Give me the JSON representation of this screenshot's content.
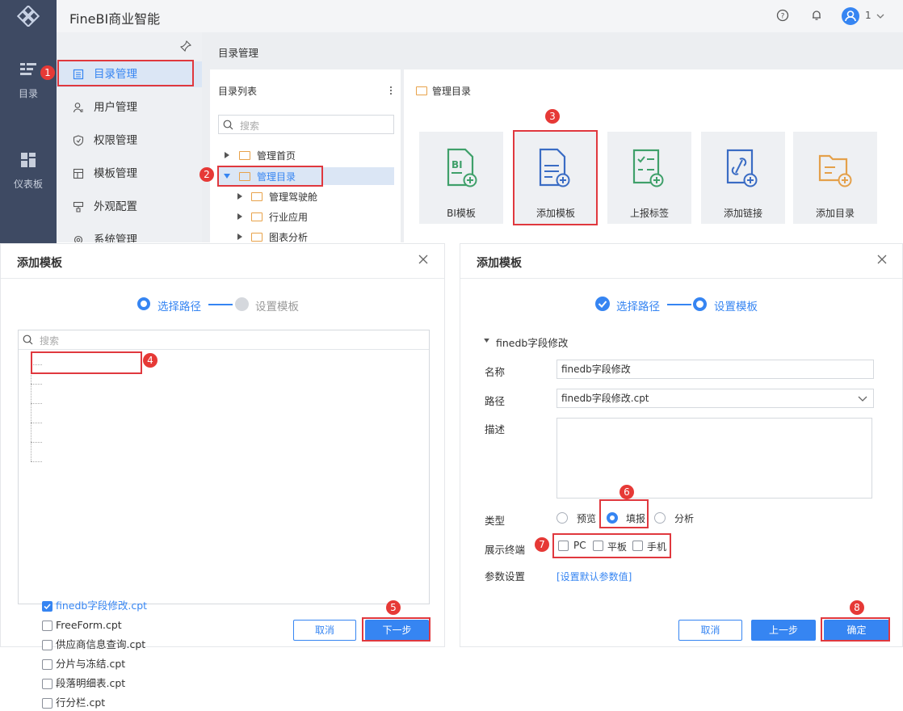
{
  "app": {
    "title": "FineBI商业智能",
    "user_num": "1"
  },
  "rail": {
    "items": [
      {
        "label": "目录"
      },
      {
        "label": "仪表板"
      }
    ]
  },
  "sidebar": {
    "items": [
      {
        "label": "目录管理"
      },
      {
        "label": "用户管理"
      },
      {
        "label": "权限管理"
      },
      {
        "label": "模板管理"
      },
      {
        "label": "外观配置"
      },
      {
        "label": "系统管理"
      }
    ]
  },
  "main": {
    "header": "目录管理",
    "list_title": "目录列表",
    "search_placeholder": "搜索",
    "tree": [
      {
        "label": "管理首页"
      },
      {
        "label": "管理目录"
      },
      {
        "label": "管理驾驶舱"
      },
      {
        "label": "行业应用"
      },
      {
        "label": "图表分析"
      }
    ],
    "detail_title": "管理目录",
    "cards": [
      {
        "label": "BI模板",
        "icon": "bi-template-icon"
      },
      {
        "label": "添加模板",
        "icon": "add-template-icon"
      },
      {
        "label": "上报标签",
        "icon": "report-tag-icon"
      },
      {
        "label": "添加链接",
        "icon": "add-link-icon"
      },
      {
        "label": "添加目录",
        "icon": "add-folder-icon"
      }
    ]
  },
  "dialog1": {
    "title": "添加模板",
    "steps": [
      "选择路径",
      "设置模板"
    ],
    "search_placeholder": "搜索",
    "files": [
      {
        "name": "finedb字段修改.cpt",
        "checked": true
      },
      {
        "name": "FreeForm.cpt",
        "checked": false
      },
      {
        "name": "供应商信息查询.cpt",
        "checked": false
      },
      {
        "name": "分片与冻结.cpt",
        "checked": false
      },
      {
        "name": "段落明细表.cpt",
        "checked": false
      },
      {
        "name": "行分栏.cpt",
        "checked": false
      }
    ],
    "cancel": "取消",
    "next": "下一步"
  },
  "dialog2": {
    "title": "添加模板",
    "steps": [
      "选择路径",
      "设置模板"
    ],
    "section": "finedb字段修改",
    "name_label": "名称",
    "name_value": "finedb字段修改",
    "path_label": "路径",
    "path_value": "finedb字段修改.cpt",
    "desc_label": "描述",
    "type_label": "类型",
    "types": [
      "预览",
      "填报",
      "分析"
    ],
    "selected_type": "填报",
    "terminal_label": "展示终端",
    "terminals": [
      "PC",
      "平板",
      "手机"
    ],
    "param_label": "参数设置",
    "param_link": "[设置默认参数值]",
    "cancel": "取消",
    "prev": "上一步",
    "confirm": "确定"
  },
  "badges": [
    "1",
    "2",
    "3",
    "4",
    "5",
    "6",
    "7",
    "8"
  ],
  "colors": {
    "accent": "#3685f2",
    "highlight": "#e0383e",
    "rail": "#3e4a63"
  }
}
